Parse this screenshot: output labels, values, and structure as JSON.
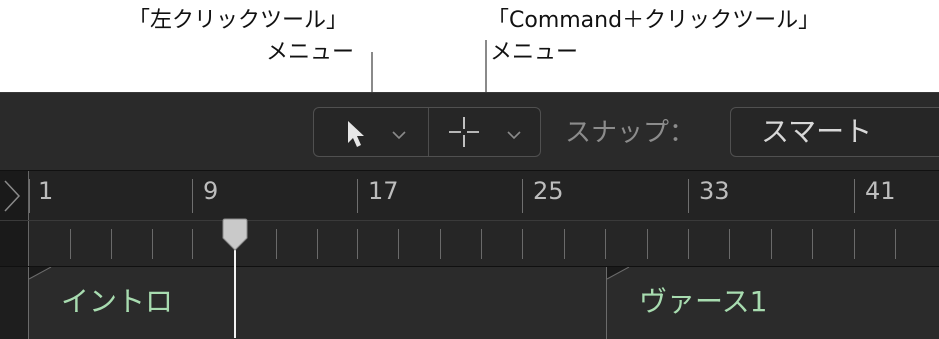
{
  "callouts": {
    "left_tool": {
      "line1": "「左クリックツール」",
      "line2": "メニュー"
    },
    "cmd_tool": {
      "line1": "「Command＋クリックツール」",
      "line2": "メニュー"
    }
  },
  "toolbar": {
    "left_tool_icon": "arrow-pointer-icon",
    "cmd_tool_icon": "crosshair-icon",
    "snap_label": "スナップ：",
    "snap_value": "スマート"
  },
  "ruler": {
    "bars": [
      "1",
      "9",
      "17",
      "25",
      "33",
      "41"
    ]
  },
  "markers": [
    {
      "label": "イントロ"
    },
    {
      "label": "ヴァース1"
    }
  ],
  "colors": {
    "marker_text": "#a8dcb0",
    "background": "#2a2a2a",
    "playhead": "#f2f2f2"
  }
}
